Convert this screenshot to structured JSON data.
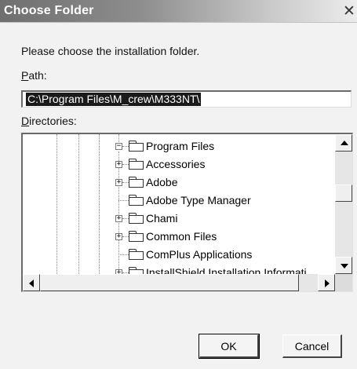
{
  "window": {
    "title": "Choose Folder",
    "close_glyph": "✕"
  },
  "prompt": "Please choose the installation folder.",
  "path": {
    "label": "Path:",
    "value": "C:\\Program Files\\M_crew\\M333NT\\"
  },
  "directories": {
    "label": "Directories:",
    "items": [
      {
        "label": "Program Files",
        "expander": "−"
      },
      {
        "label": "Accessories",
        "expander": "+"
      },
      {
        "label": "Adobe",
        "expander": "+"
      },
      {
        "label": "Adobe Type Manager",
        "expander": ""
      },
      {
        "label": "Chami",
        "expander": "+"
      },
      {
        "label": "Common Files",
        "expander": "+"
      },
      {
        "label": "ComPlus Applications",
        "expander": ""
      },
      {
        "label": "InstallShield Installation Informati",
        "expander": "+"
      }
    ]
  },
  "buttons": {
    "ok": "OK",
    "cancel": "Cancel"
  },
  "icons": [
    "close-icon",
    "folder-icon",
    "expand-icon",
    "collapse-icon",
    "scroll-up-arrow-icon",
    "scroll-down-arrow-icon",
    "scroll-left-arrow-icon",
    "scroll-right-arrow-icon"
  ]
}
